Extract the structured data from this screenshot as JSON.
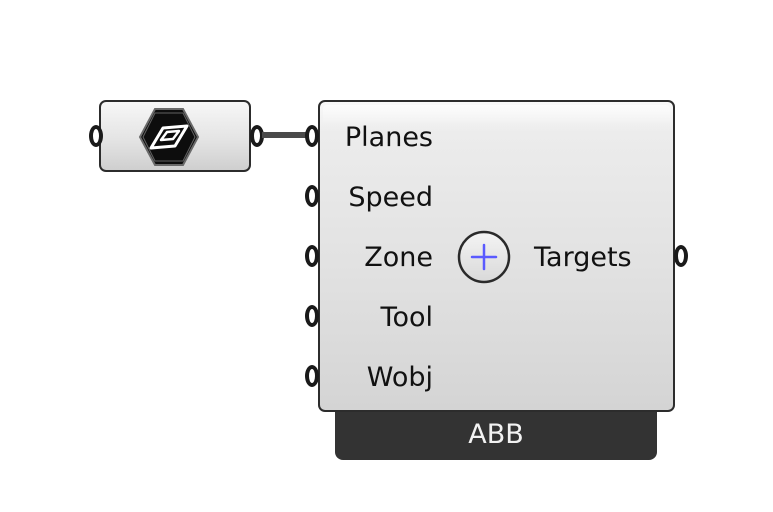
{
  "canvas": {
    "background_color": "#ffffff"
  },
  "plane_param": {
    "icon": "plane-parameter-icon"
  },
  "component": {
    "inputs": [
      {
        "label": "Planes"
      },
      {
        "label": "Speed"
      },
      {
        "label": "Zone"
      },
      {
        "label": "Tool"
      },
      {
        "label": "Wobj"
      }
    ],
    "output": {
      "label": "Targets"
    },
    "center_icon": "plus-icon",
    "category": "ABB"
  },
  "colors": {
    "component_border": "#2c2c2c",
    "wire": "#4a4a4a",
    "category_bg": "#333333",
    "plus_icon_stroke": "#5a5aff"
  }
}
